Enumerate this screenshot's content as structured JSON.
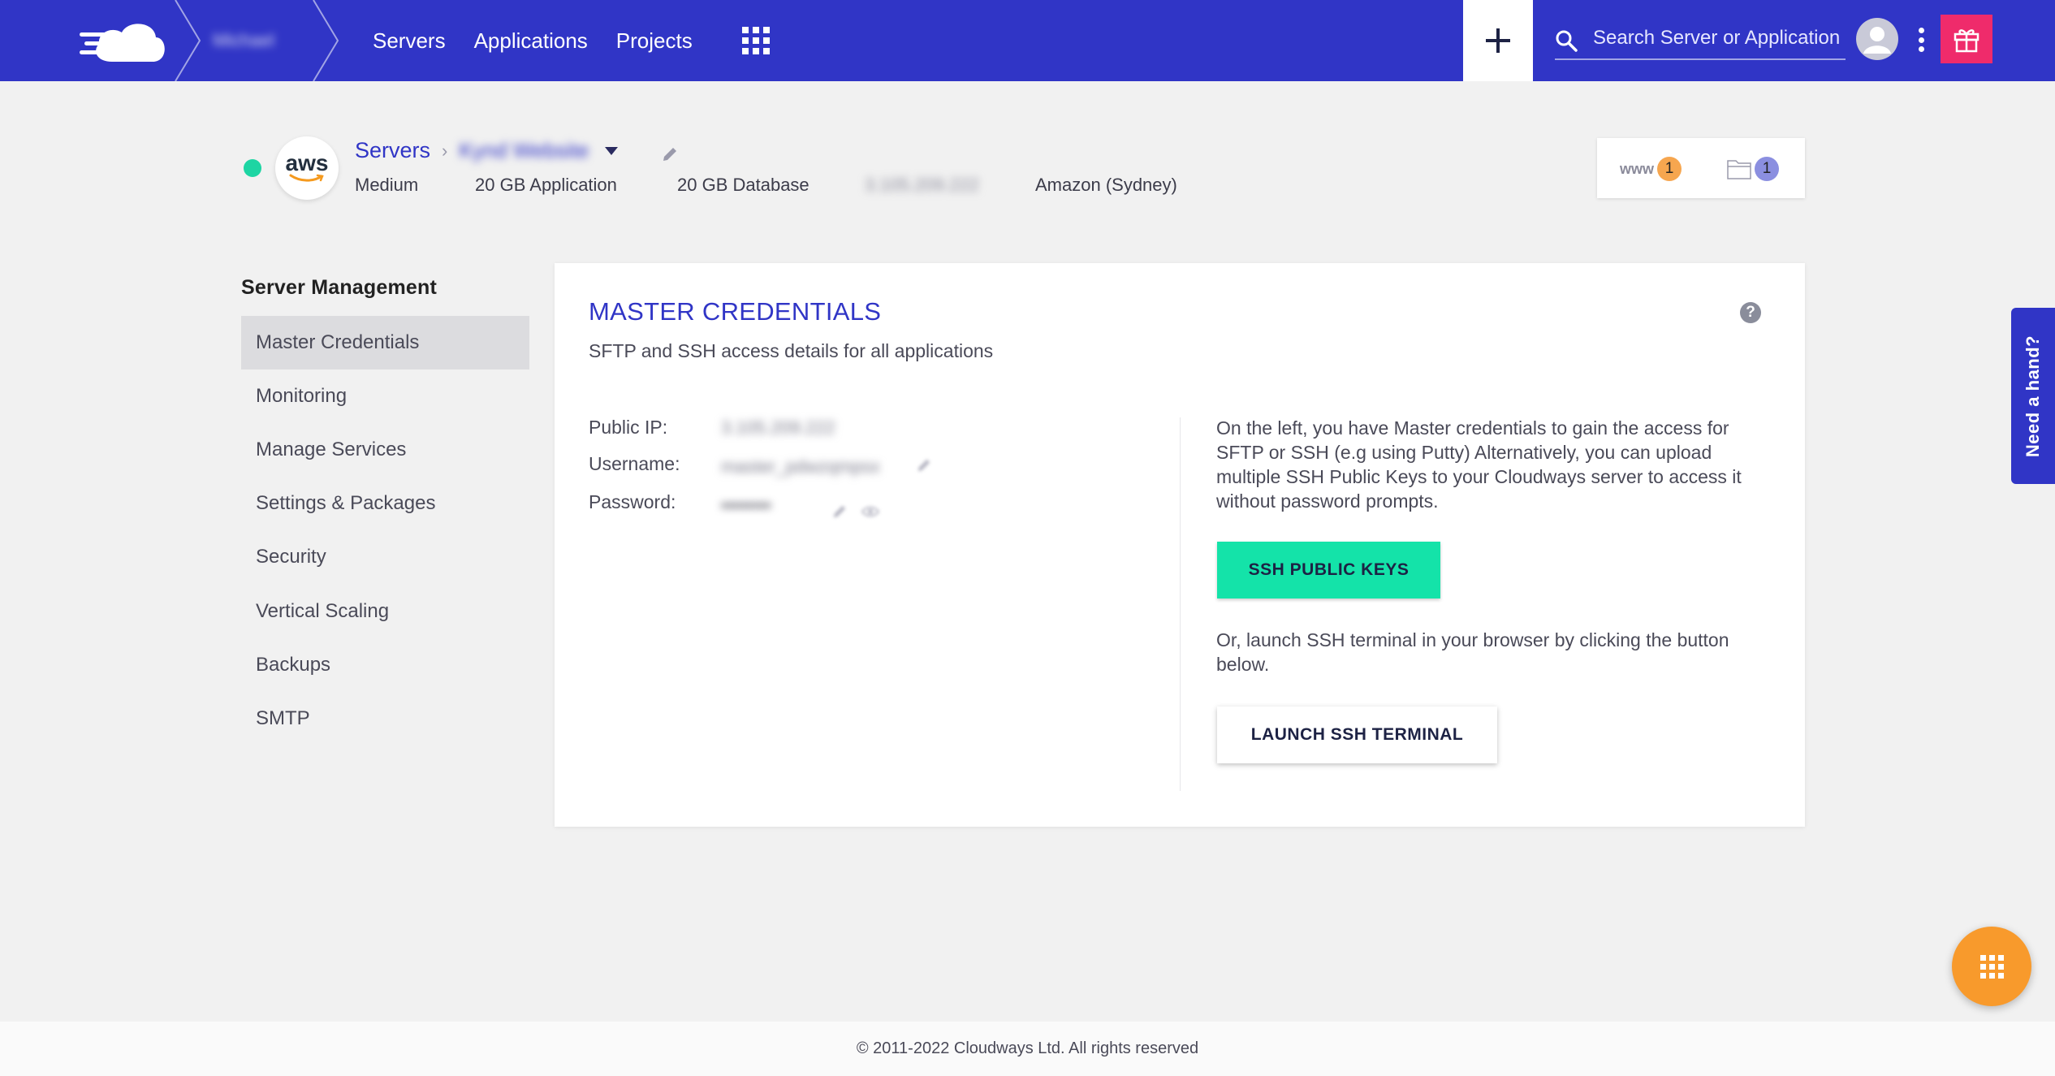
{
  "header": {
    "user_name": "Michael",
    "nav": [
      "Servers",
      "Applications",
      "Projects"
    ],
    "search_placeholder": "Search Server or Application"
  },
  "server": {
    "breadcrumb_root": "Servers",
    "name": "Kynd Website",
    "size": "Medium",
    "app_storage": "20 GB Application",
    "db_storage": "20 GB Database",
    "ip": "3.105.209.222",
    "location": "Amazon (Sydney)",
    "provider_logo_text": "aws",
    "www_label": "www",
    "apps_count": "1",
    "projects_count": "1"
  },
  "sidebar": {
    "title": "Server Management",
    "items": [
      "Master Credentials",
      "Monitoring",
      "Manage Services",
      "Settings & Packages",
      "Security",
      "Vertical Scaling",
      "Backups",
      "SMTP"
    ]
  },
  "card": {
    "title": "MASTER CREDENTIALS",
    "subtitle": "SFTP and SSH access details for all applications",
    "help": "?",
    "public_ip_label": "Public IP:",
    "public_ip_value": "3.105.209.222",
    "username_label": "Username:",
    "username_value": "master_pdwzqmpsx",
    "password_label": "Password:",
    "password_value": "••••••••",
    "info_text": "On the left, you have Master credentials to gain the access for SFTP or SSH (e.g using Putty) Alternatively, you can upload multiple SSH Public Keys to your Cloudways server to access it without password prompts.",
    "ssh_keys_button": "SSH PUBLIC KEYS",
    "terminal_text": "Or, launch SSH terminal in your browser by clicking the button below.",
    "terminal_button": "LAUNCH SSH TERMINAL"
  },
  "help_tab": "Need a hand?",
  "footer": "© 2011-2022 Cloudways Ltd. All rights reserved",
  "colors": {
    "brand": "#3035c6",
    "accent_green": "#14e3a9",
    "status": "#1dd5a3",
    "gift": "#ef2b6b",
    "fab": "#f89a2c"
  }
}
